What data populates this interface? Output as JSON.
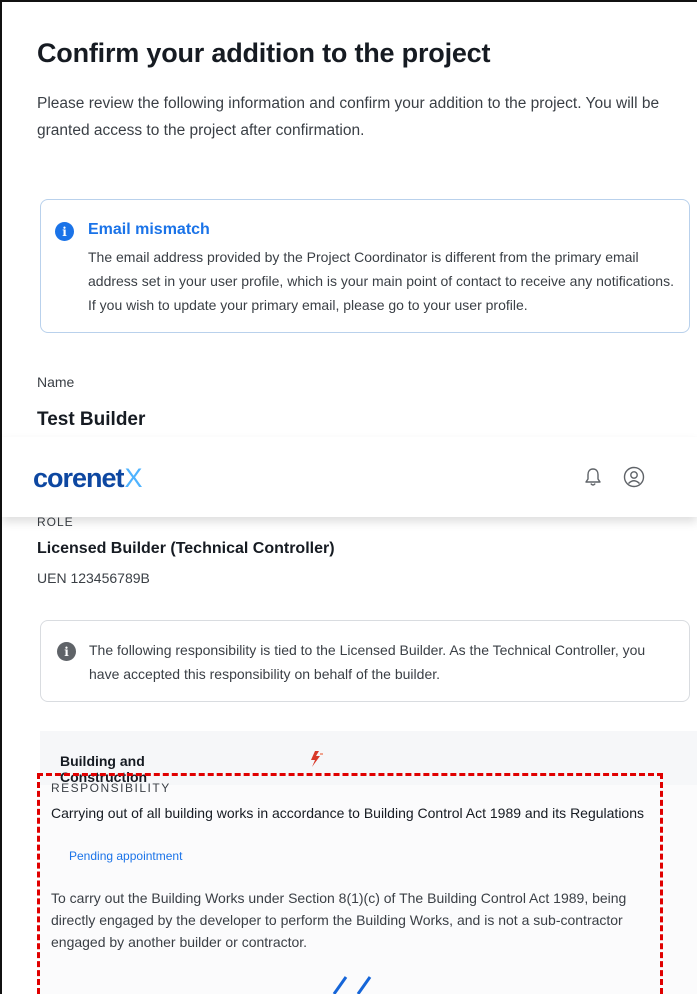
{
  "page": {
    "title": "Confirm your addition to the project",
    "intro": "Please review the following information and confirm your addition to the project. You will be granted access to the project after confirmation."
  },
  "alert": {
    "icon": "info-icon",
    "title": "Email mismatch",
    "body": "The email address provided by the Project Coordinator is different from the primary email address set in your user profile, which is your main point of contact to receive any notifications. If you wish to update your primary email, please go to your user profile."
  },
  "name": {
    "label": "Name",
    "value": "Test Builder"
  },
  "topbar": {
    "logo_text": "corenet",
    "logo_mark": "X",
    "icons": [
      "bell-icon",
      "user-icon"
    ]
  },
  "role": {
    "label": "ROLE",
    "value": "Licensed Builder (Technical Controller)",
    "uen": "UEN 123456789B"
  },
  "notice": {
    "icon": "info-icon",
    "text": "The following responsibility is tied to the Licensed Builder. As the Technical Controller, you have accepted this responsibility on behalf of the builder."
  },
  "responsibility": {
    "agency": "Building and Construction Authority (BCA)",
    "label": "RESPONSIBILITY",
    "title": "Carrying out of all building works in accordance to Building Control Act 1989 and its Regulations",
    "status": "Pending appointment",
    "description": "To carry out the Building Works under Section 8(1)(c) of The Building Control Act 1989, being directly engaged by the developer to perform the Building Works, and is not a sub-contractor engaged by another builder or contractor."
  },
  "colors": {
    "accent": "#1a73e8",
    "brand": "#0d47a1",
    "brand_mark": "#4fb3ff",
    "highlight": "#e00000"
  }
}
